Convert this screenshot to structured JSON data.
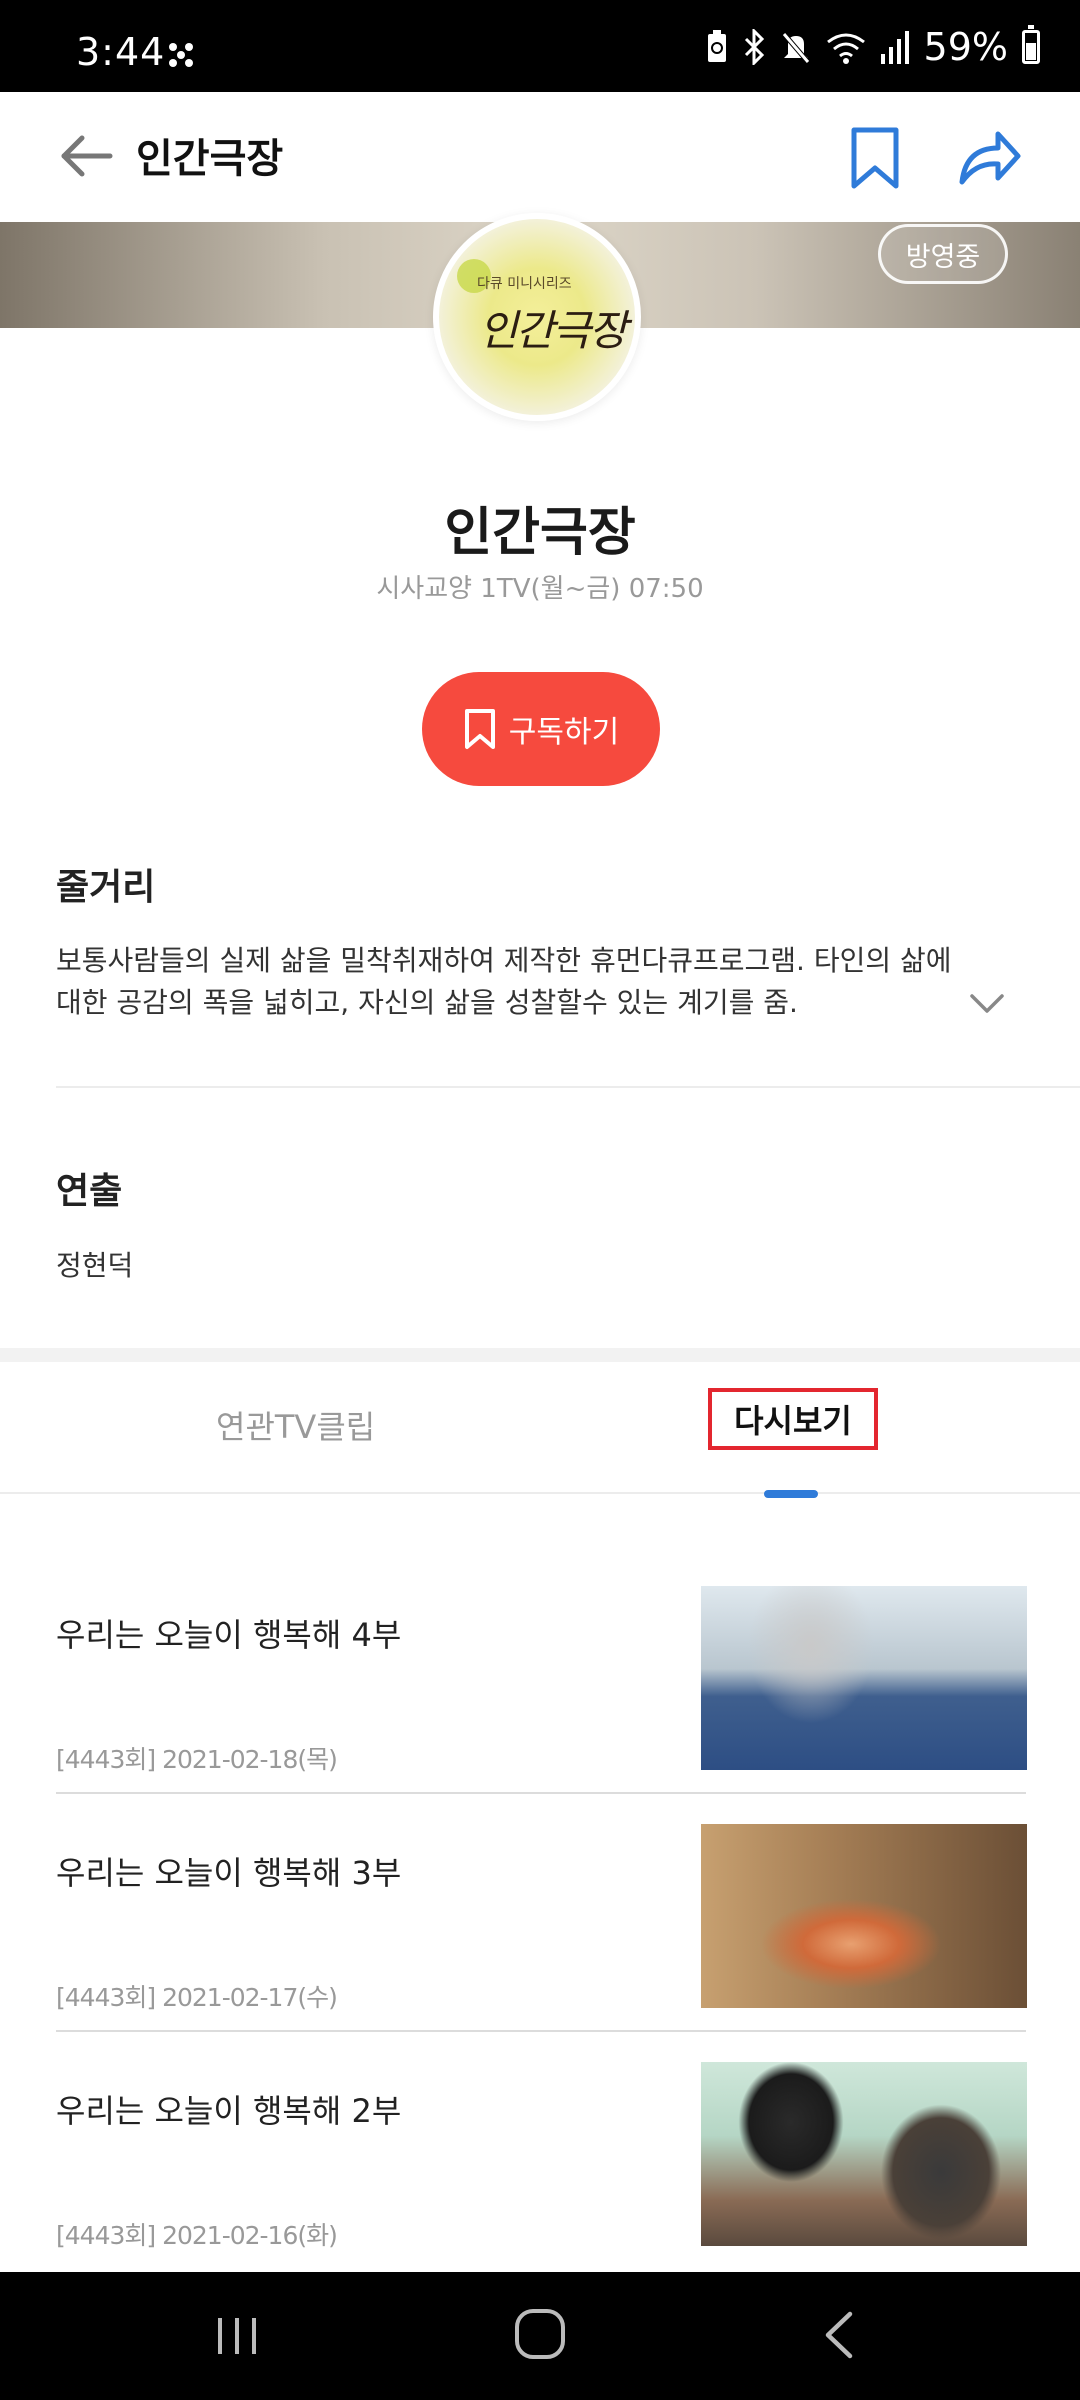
{
  "status_bar": {
    "time": "3:44",
    "battery_percent": "59%",
    "battery_level": 0.59,
    "icons": [
      "grid-dots-icon",
      "battery-saver-icon",
      "bluetooth-icon",
      "mute-icon",
      "wifi-icon",
      "signal-icon",
      "battery-icon"
    ]
  },
  "appbar": {
    "title": "인간극장",
    "back_icon": "arrow-left-icon",
    "bookmark_icon": "bookmark-icon",
    "share_icon": "share-icon"
  },
  "banner": {
    "badge": "방영중",
    "logo_sub": "다큐 미니시리즈",
    "logo_main": "인간극장"
  },
  "program": {
    "title": "인간극장",
    "meta": "시사교양 1TV(월~금) 07:50",
    "subscribe_label": "구독하기"
  },
  "synopsis": {
    "heading": "줄거리",
    "text": "보통사람들의 실제 삶을 밀착취재하여 제작한 휴먼다큐프로그램. 타인의 삶에 대한 공감의 폭을 넓히고, 자신의 삶을 성찰할수 있는 계기를 줌."
  },
  "director": {
    "heading": "연출",
    "name": "정현덕"
  },
  "tabs": [
    {
      "label": "연관TV클립",
      "selected": false
    },
    {
      "label": "다시보기",
      "selected": true
    }
  ],
  "episodes": [
    {
      "title": "우리는 오늘이 행복해 4부",
      "date": "[4443회] 2021-02-18(목)"
    },
    {
      "title": "우리는 오늘이 행복해 3부",
      "date": "[4443회] 2021-02-17(수)"
    },
    {
      "title": "우리는 오늘이 행복해 2부",
      "date": "[4443회] 2021-02-16(화)"
    }
  ],
  "colors": {
    "accent_red": "#f64a3e",
    "tab_indicator_blue": "#2f7bd9",
    "icon_blue": "#2f7bd9",
    "highlight_box": "#e3262f"
  }
}
